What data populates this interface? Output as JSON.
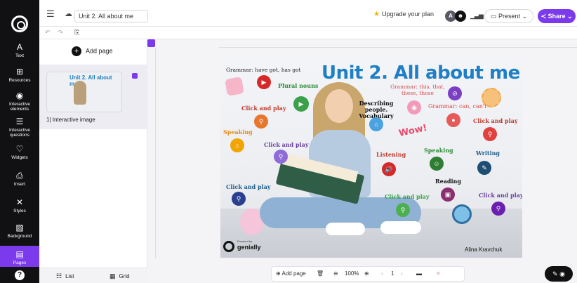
{
  "rail": {
    "items": [
      {
        "label": "Text",
        "icon": "A"
      },
      {
        "label": "Resources",
        "icon": "⊞"
      },
      {
        "label": "Interactive elements",
        "icon": "◉"
      },
      {
        "label": "Interactive questions",
        "icon": "☰"
      },
      {
        "label": "Widgets",
        "icon": "♡"
      },
      {
        "label": "Insert",
        "icon": "⎙"
      },
      {
        "label": "Styles",
        "icon": "✕"
      },
      {
        "label": "Background",
        "icon": "▨"
      },
      {
        "label": "Pages",
        "icon": "▤"
      }
    ],
    "help": "?"
  },
  "topbar": {
    "menu_icon": "☰",
    "title": "Unit 2. All about me",
    "upgrade_label": "Upgrade your plan",
    "avatar_a": "A",
    "present_label": "Present",
    "share_label": "Share"
  },
  "pages_panel": {
    "add_page_label": "Add page",
    "thumb_title": "Unit 2. All about me",
    "page_label": "1| Interactive image",
    "tab_list": "List",
    "tab_grid": "Grid"
  },
  "slide": {
    "title": "Unit 2. All about me",
    "texts": {
      "grammar_have": "Grammar: have got, has got",
      "plural": "Plural nouns",
      "grammar_this": "Grammar: this, that, these, those",
      "describing": "Describing people. Vocabulary",
      "grammar_can": "Grammar: can, can't",
      "click1": "Click and play",
      "speaking1": "Speaking",
      "click2": "Click and play",
      "click3": "Click and play",
      "listening": "Listening",
      "speaking2": "Speaking",
      "writing": "Writing",
      "click4": "Click and play",
      "reading": "Reading",
      "click5": "Click and play",
      "click6": "Click and play",
      "wow": "Wow!",
      "powered": "Powered by",
      "genially": "genially",
      "author": "Alina Kravchuk"
    }
  },
  "bottom_bar": {
    "add_page": "Add page",
    "zoom": "100%",
    "page_num": "1"
  },
  "colors": {
    "accent": "#7c3aed",
    "title_blue": "#1e7fc4",
    "click_red": "#c0392b",
    "green": "#3aa14a",
    "orange": "#e88a1a",
    "purple": "#6b3fa0",
    "pink_red": "#e74c6f"
  }
}
